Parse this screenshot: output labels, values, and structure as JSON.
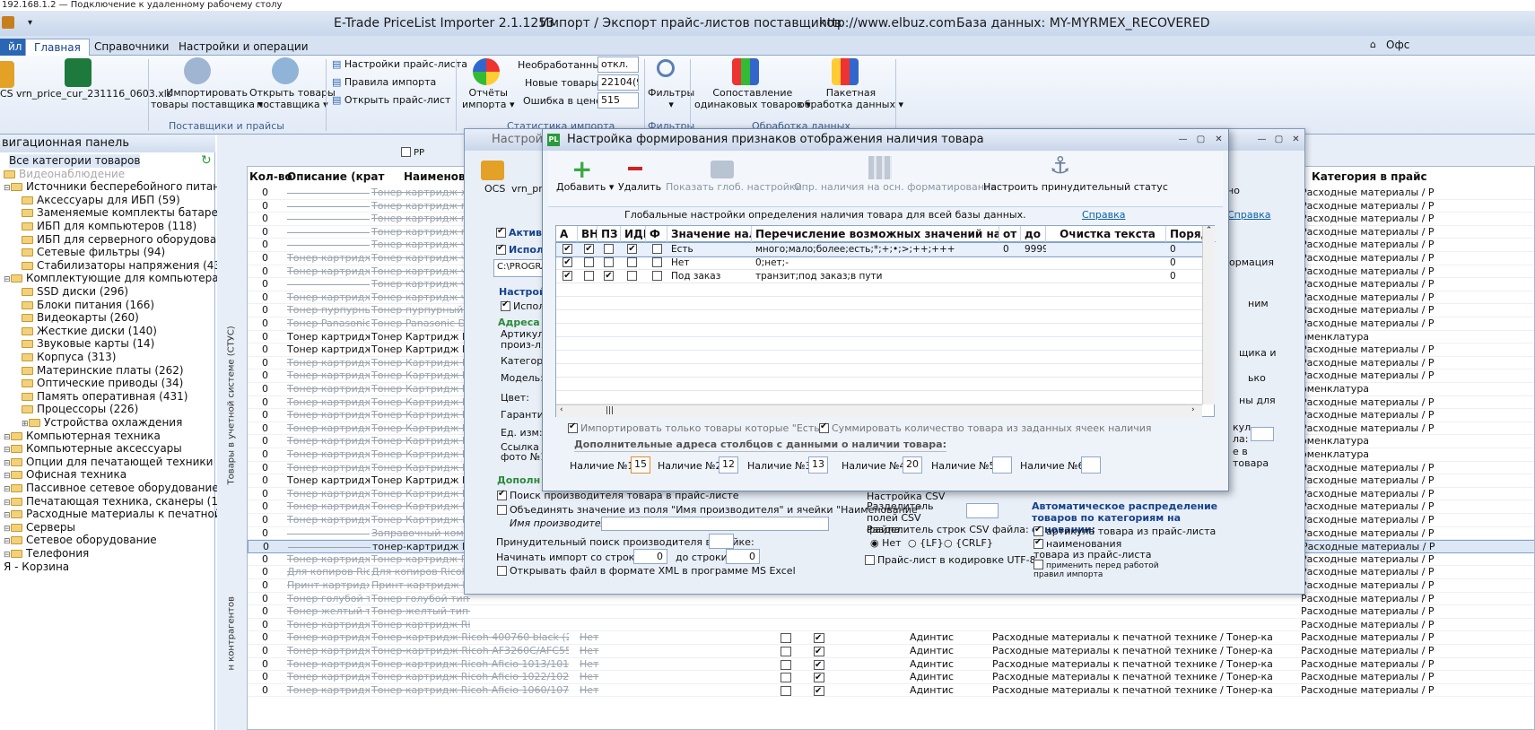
{
  "remote_title": "192.168.1.2 — Подключение к удаленному рабочему столу",
  "app_title": {
    "name": "E-Trade PriceList Importer 2.1.1253",
    "subtitle": "Импорт / Экспорт прайс-листов поставщиков",
    "url": "http://www.elbuz.com",
    "db": "База данных: MY-MYRMEX_RECOVERED"
  },
  "tabs": [
    "йл",
    "Главная",
    "Справочники",
    "Настройки и операции"
  ],
  "right_tab": "Офс",
  "ribbon": {
    "file_name": "vrn_price_cur_231116_0603.xls",
    "cs": "CS",
    "import_goods": [
      "Импортировать",
      "товары поставщика"
    ],
    "open_goods": [
      "Открыть товары",
      "поставщика"
    ],
    "group1": "Поставщики и прайсы",
    "pl_settings": "Настройки прайс-листа",
    "import_rules": "Правила импорта",
    "open_pl": "Открыть прайс-лист",
    "reports": [
      "Отчёты",
      "импорта"
    ],
    "stats": [
      {
        "label": "Необработанные",
        "value": "откл."
      },
      {
        "label": "Новые товары",
        "value": "22104(96"
      },
      {
        "label": "Ошибка в цене",
        "value": "515"
      }
    ],
    "group2": "Статистика импорта",
    "filters": "Фильтры",
    "group3": "Фильтры",
    "compare": [
      "Сопоставление",
      "одинаковых товаров"
    ],
    "batch": [
      "Пакетная",
      "обработка данных"
    ],
    "group4": "Обработка данных"
  },
  "nav": {
    "title": "вигационная панель",
    "items": [
      "Все категории товаров",
      "Видеонаблюдение",
      "Источники бесперебойного питания",
      "Аксессуары для ИБП (59)",
      "Заменяемые комплекты батарей",
      "ИБП для компьютеров (118)",
      "ИБП для серверного оборудовани",
      "Сетевые фильтры (94)",
      "Стабилизаторы напряжения (43)",
      "Комплектующие для компьютера",
      "SSD диски (296)",
      "Блоки питания (166)",
      "Видеокарты (260)",
      "Жесткие диски (140)",
      "Звуковые карты (14)",
      "Корпуса (313)",
      "Материнские платы (262)",
      "Оптические приводы (34)",
      "Память оперативная (431)",
      "Процессоры (226)",
      "Устройства охлаждения",
      "Компьютерная техника",
      "Компьютерные аксессуары",
      "Опции для печатающей техники",
      "Офисная техника",
      "Пассивное сетевое оборудование",
      "Печатающая техника, сканеры (1)",
      "Расходные материалы к печатной те",
      "Серверы",
      "Сетевое оборудование",
      "Телефония",
      "Я - Корзина"
    ]
  },
  "grid": {
    "headers": [
      "Кол-во",
      "Описание (крат",
      "Наименован",
      "Категория в прайс"
    ],
    "pp": "PP",
    "vertical_label": "Товары в учетной системе (СТУС)",
    "vertical_label2": "н контрагентов",
    "rows": [
      {
        "q": "0",
        "d": "",
        "n": "Тонер картридж желт",
        "c": "Расходные материалы / Р",
        "s": true
      },
      {
        "q": "0",
        "d": "",
        "n": "Тонер картридж пурп",
        "c": "Расходные материалы / Р",
        "s": true
      },
      {
        "q": "0",
        "d": "",
        "n": "Тонер картридж пурп",
        "c": "Расходные материалы / Р",
        "s": true
      },
      {
        "q": "0",
        "d": "",
        "n": "Тонер картридж пурп",
        "c": "Расходные материалы / Р",
        "s": true
      },
      {
        "q": "0",
        "d": "",
        "n": "Тонер картридж черн",
        "c": "Расходные материалы / Р",
        "s": true
      },
      {
        "q": "0",
        "d": "Тонер картридж ча",
        "n": "Тонер картридж черн",
        "c": "Расходные материалы / Р",
        "s": true
      },
      {
        "q": "0",
        "d": "Тонер картридж че",
        "n": "Тонер картридж черн",
        "c": "Расходные материалы / Р",
        "s": true
      },
      {
        "q": "0",
        "d": "",
        "n": "Тонер картридж черн",
        "c": "Расходные материалы / Р",
        "s": true
      },
      {
        "q": "0",
        "d": "Тонер картридж че",
        "n": "Тонер картридж черн",
        "c": "Расходные материалы / Р",
        "s": true
      },
      {
        "q": "0",
        "d": "Тонер пурпурный О",
        "n": "Тонер пурпурный OKI",
        "c": "Расходные материалы / Р",
        "s": true
      },
      {
        "q": "0",
        "d": "Тонер Panasonic DP",
        "n": "Тонер Panasonic DP-15",
        "c": "Расходные материалы / Р",
        "s": true
      },
      {
        "q": "0",
        "d": "Тонер картридж Ра",
        "n": "Тонер Картридж Panas",
        "c": "оменклатура",
        "s": false
      },
      {
        "q": "0",
        "d": "Тонер картридж Ра",
        "n": "Тонер Картридж Panas",
        "c": "Расходные материалы / Р",
        "s": false
      },
      {
        "q": "0",
        "d": "Тонер картридж Ра",
        "n": "Тонер Картридж Panas",
        "c": "Расходные материалы / Р",
        "s": true
      },
      {
        "q": "0",
        "d": "Тонер картридж Ра",
        "n": "Тонер Картридж Panas",
        "c": "Расходные материалы / Р",
        "s": true
      },
      {
        "q": "0",
        "d": "Тонер картридж Ра",
        "n": "Тонер Картридж Panas",
        "c": "оменклатура",
        "s": true
      },
      {
        "q": "0",
        "d": "Тонер картридж Ра",
        "n": "Тонер Картридж Panas",
        "c": "Расходные материалы / Р",
        "s": true
      },
      {
        "q": "0",
        "d": "Тонер картридж Ра",
        "n": "Тонер Картридж Panas",
        "c": "Расходные материалы / Р",
        "s": true
      },
      {
        "q": "0",
        "d": "Тонер картридж Ра",
        "n": "Тонер Картридж Panas",
        "c": "Расходные материалы / Р",
        "s": true
      },
      {
        "q": "0",
        "d": "Тонер картридж Ра",
        "n": "Тонер Картридж Panas",
        "c": "оменклатура",
        "s": true
      },
      {
        "q": "0",
        "d": "Тонер картридж Ра",
        "n": "Тонер Картридж Panas",
        "c": "оменклатура",
        "s": true
      },
      {
        "q": "0",
        "d": "Тонер картридж Ра",
        "n": "Тонер Картридж Panas",
        "c": "Расходные материалы / Р",
        "s": true
      },
      {
        "q": "0",
        "d": "Тонер картридж Ра",
        "n": "Тонер Картридж Panas",
        "c": "Расходные материалы / Р",
        "s": false
      },
      {
        "q": "0",
        "d": "Тонер картридж Ра",
        "n": "Тонер Картридж Panas",
        "c": "Расходные материалы / Р",
        "s": true
      },
      {
        "q": "0",
        "d": "Тонер картридж Ра",
        "n": "Тонер Картридж Panas",
        "c": "Расходные материалы / Р",
        "s": true
      },
      {
        "q": "0",
        "d": "Тонер картридж Ра",
        "n": "Тонер Картридж Panas",
        "c": "Расходные материалы / Р",
        "s": true
      },
      {
        "q": "0",
        "d": "",
        "n": "Заправочный комплект",
        "c": "Расходные материалы / Р",
        "s": true
      },
      {
        "q": "0",
        "d": "",
        "n": "тонер-картридж Pantu",
        "c": "Расходные материалы / Р",
        "s": false
      },
      {
        "q": "0",
        "d": "Тонер картридж Ра",
        "n": "Тонер картридж Pantu",
        "c": "Расходные материалы / Р",
        "s": true
      },
      {
        "q": "0",
        "d": "Для копиров Ricoh",
        "n": "Для копиров Ricoh Typ",
        "c": "Расходные материалы / Р",
        "s": true
      },
      {
        "q": "0",
        "d": "Принт картридж Ri",
        "n": "Принт картридж Ricoh",
        "c": "Расходные материалы / Р",
        "s": true
      },
      {
        "q": "0",
        "d": "Тонер голубой тип",
        "n": "Тонер голубой тип С7",
        "c": "Расходные материалы / Р",
        "s": true
      },
      {
        "q": "0",
        "d": "Тонер желтый тип",
        "n": "Тонер желтый тип С7",
        "c": "Расходные материалы / Р",
        "s": true
      },
      {
        "q": "0",
        "d": "Тонер картридж Ri",
        "n": "Тонер картридж Ricoh",
        "c": "Расходные материалы / Р",
        "s": true
      },
      {
        "q": "0",
        "d": "Тонер картридж Ri",
        "n": "Тонер-картридж Ricoh 400760 black (20",
        "c": "Расходные материалы / Р",
        "s": true,
        "st": "Нет",
        "sup": "Адинтис",
        "cat": "Расходные материалы к печатной технике / Тонер-ка"
      },
      {
        "q": "0",
        "d": "Тонер картридж Ri",
        "n": "Тонер-картридж Ricoh AF3260C/AFC550",
        "c": "Расходные материалы / Р",
        "s": true,
        "st": "Нет",
        "sup": "Адинтис",
        "cat": "Расходные материалы к печатной технике / Тонер-ка"
      },
      {
        "q": "0",
        "d": "Тонер картридж Ri",
        "n": "Тонер картридж Ricoh Aficio 1013/1013",
        "c": "Расходные материалы / Р",
        "s": true,
        "st": "Нет",
        "sup": "Адинтис",
        "cat": "Расходные материалы к печатной технике / Тонер-ка"
      },
      {
        "q": "0",
        "d": "Тонер картридж Ri",
        "n": "Тонер картридж Ricoh Aficio 1022/1027",
        "c": "Расходные материалы / Р",
        "s": true,
        "st": "Нет",
        "sup": "Адинтис",
        "cat": "Расходные материалы к печатной технике / Тонер-ка"
      },
      {
        "q": "0",
        "d": "Тонер картридж Ri",
        "n": "Тонер картридж Ricoh Aficio 1060/1075",
        "c": "Расходные материалы / Р",
        "s": true,
        "st": "Нет",
        "sup": "Адинтис",
        "cat": "Расходные материалы к печатной технике / Тонер-ка"
      }
    ]
  },
  "dlg1": {
    "title": "Настрой",
    "cs": "OCS",
    "vrn": "vrn_pri",
    "active": "Активе",
    "use": "Исполь",
    "path": "C:\\PROGRA",
    "settings": "Настрой",
    "use2": "Исполь",
    "addr": "Адреса с",
    "fields": [
      "Артикул",
      "произ-ля:",
      "Категория",
      "Модель:",
      "Цвет:",
      "Гарантия",
      "Ед. изм:",
      "Ссылка на",
      "фото №1"
    ],
    "more": "Дополн",
    "find_maker": "Поиск производителя товара в прайс-листе",
    "merge": "Объединять значение из поля \"Имя производителя\" и ячейки \"Наименование\"",
    "maker_name": "Имя производителя:",
    "force": "Принудительный поиск производителя в ячейке:",
    "start_row": "Начинать импорт со строки №:",
    "start_val": "0",
    "to_row": "до строки:",
    "to_val": "0",
    "open_xml": "Открывать файл в формате XML в программе MS Excel",
    "csv_title": "Настройка CSV",
    "csv_field": "Разделитель полей CSV файла:",
    "csv_row": "Разделитель строк CSV файла:",
    "csv_opts": [
      "Нет",
      "{LF}",
      "{CRLF}"
    ],
    "utf8": "Прайс-лист в кодировке UTF-8",
    "auto_title": "Автоматическое распределение товаров по категориям на основании:",
    "auto_opts": [
      "артикула товара из прайс-листа",
      "наименования товара из прайс-листа",
      "применить перед работой правил импорта"
    ],
    "right_texts": [
      "Справка",
      "но",
      "ормация",
      "ним",
      "щика и",
      "ько",
      "ны для",
      "кул,",
      "ла:",
      "е в",
      "товара"
    ]
  },
  "dlg2": {
    "title": "Настройка формирования признаков отображения наличия товара",
    "toolbar": [
      "Добавить",
      "Удалить",
      "Показать глоб. настройки",
      "Опр. наличия на осн. форматирования",
      "Настроить принудительный статус"
    ],
    "global": "Глобальные настройки определения наличия товара для всей базы данных.",
    "help": "Справка",
    "cols": [
      "A",
      "ВН",
      "ПЗ",
      "ИДН",
      "Ф",
      "Значение наличи",
      "Перечисление возможных значений наличия",
      "от",
      "до",
      "Очистка текста",
      "Поряд"
    ],
    "rows": [
      {
        "a": true,
        "vn": true,
        "pz": false,
        "idn": true,
        "f": false,
        "v": "Есть",
        "e": "много;мало;более;есть;*;+;•;>;++;+++",
        "from": "0",
        "to": "9999",
        "c": "",
        "o": "0"
      },
      {
        "a": true,
        "vn": false,
        "pz": false,
        "idn": false,
        "f": false,
        "v": "Нет",
        "e": "0;нет;-",
        "from": "",
        "to": "",
        "c": "",
        "o": "0"
      },
      {
        "a": true,
        "vn": false,
        "pz": true,
        "idn": false,
        "f": false,
        "v": "Под заказ",
        "e": "транзит;под заказ;в пути",
        "from": "",
        "to": "",
        "c": "",
        "o": "0"
      }
    ],
    "only_exist": "Импортировать только товары которые \"Есть\"",
    "sum": "Суммировать количество товара из заданных ячеек наличия",
    "extra": "Дополнительные адреса столбцов с данными о наличии товара:",
    "avail": [
      {
        "l": "Наличие №1:",
        "v": "15"
      },
      {
        "l": "Наличие №2:",
        "v": "12"
      },
      {
        "l": "Наличие №3:",
        "v": "13"
      },
      {
        "l": "Наличие №4:",
        "v": "20"
      },
      {
        "l": "Наличие №5:",
        "v": ""
      },
      {
        "l": "Наличие №6:",
        "v": ""
      }
    ]
  },
  "colors": {
    "accent": "#15428b",
    "link": "#0a5fa8",
    "ribbon": "#e2eaf6"
  }
}
